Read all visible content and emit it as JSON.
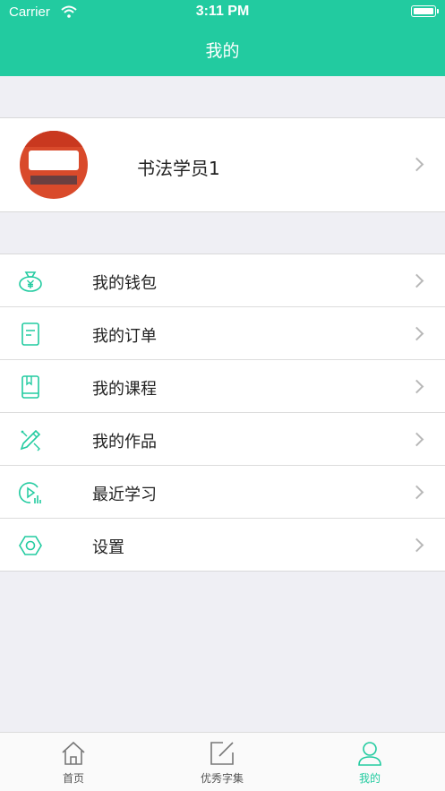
{
  "status_bar": {
    "carrier": "Carrier",
    "time": "3:11 PM"
  },
  "header": {
    "title": "我的"
  },
  "profile": {
    "name": "书法学员1"
  },
  "menu": {
    "items": [
      {
        "label": "我的钱包",
        "icon": "wallet-icon"
      },
      {
        "label": "我的订单",
        "icon": "order-icon"
      },
      {
        "label": "我的课程",
        "icon": "course-icon"
      },
      {
        "label": "我的作品",
        "icon": "works-icon"
      },
      {
        "label": "最近学习",
        "icon": "recent-study-icon"
      },
      {
        "label": "设置",
        "icon": "settings-icon"
      }
    ]
  },
  "tabbar": {
    "tabs": [
      {
        "label": "首页",
        "icon": "home-icon",
        "active": false
      },
      {
        "label": "优秀字集",
        "icon": "edit-icon",
        "active": false
      },
      {
        "label": "我的",
        "icon": "user-icon",
        "active": true
      }
    ]
  },
  "colors": {
    "accent": "#22cba0",
    "background": "#efeff4"
  }
}
